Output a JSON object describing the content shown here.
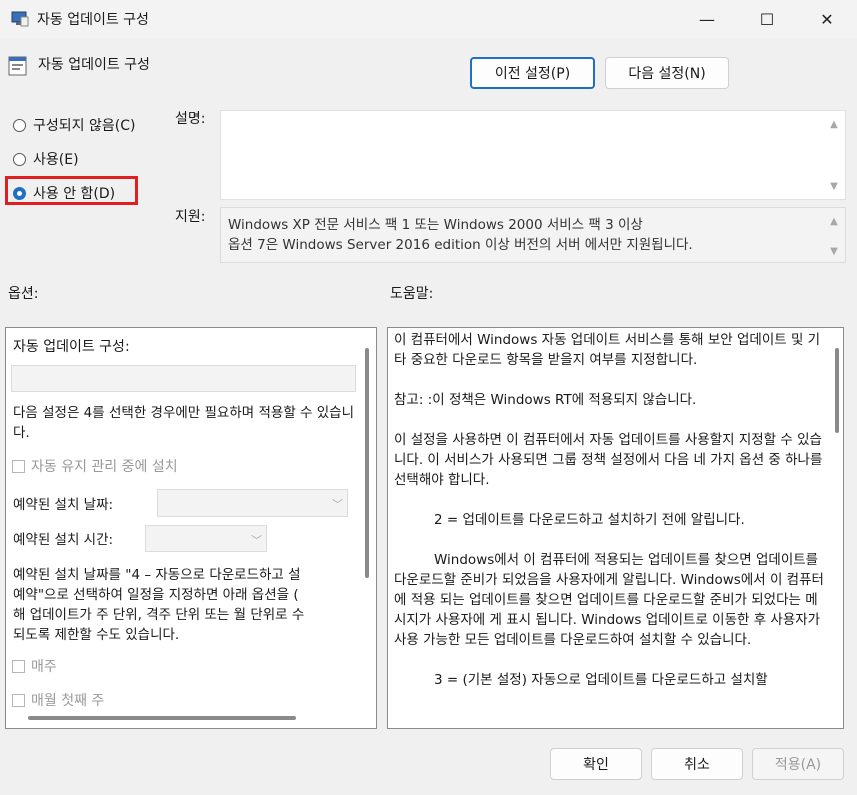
{
  "window": {
    "title": "자동 업데이트 구성",
    "minimize": "—",
    "maximize": "☐",
    "close": "✕"
  },
  "header": {
    "policy_name": "자동 업데이트 구성",
    "prev_button": "이전 설정(P)",
    "next_button": "다음 설정(N)"
  },
  "state": {
    "not_configured": "구성되지 않음(C)",
    "enabled": "사용(E)",
    "disabled": "사용 안 함(D)",
    "selected": "disabled"
  },
  "comment": {
    "label": "설명:",
    "value": ""
  },
  "supported": {
    "label": "지원:",
    "line1": "Windows XP 전문 서비스 팩 1 또는 Windows 2000 서비스 팩 3 이상",
    "line2": "옵션 7은 Windows Server 2016 edition 이상 버전의 서버 에서만 지원됩니다."
  },
  "options": {
    "label": "옵션:",
    "configure_label": "자동 업데이트 구성:",
    "configure_value": "",
    "note1": "다음 설정은 4를 선택한 경우에만 필요하며 적용할 수 있습니다.",
    "maintenance": "자동 유지 관리 중에 설치",
    "install_day_label": "예약된 설치 날짜:",
    "install_time_label": "예약된 설치 시간:",
    "note2_l1": "예약된 설치 날짜를 \"4 – 자동으로 다운로드하고 설",
    "note2_l2": "예약\"으로 선택하여 일정을 지정하면 아래 옵션을 (",
    "note2_l3": "해 업데이트가 주 단위, 격주 단위 또는 월 단위로 수",
    "note2_l4": "되도록 제한할 수도 있습니다.",
    "weekly": "매주",
    "first_week": "매월 첫째 주"
  },
  "help": {
    "label": "도움말:",
    "p1": "이 컴퓨터에서 Windows 자동 업데이트 서비스를 통해 보안 업데이트 및 기타 중요한 다운로드 항목을 받을지 여부를 지정합니다.",
    "p2": "참고: :이 정책은 Windows RT에 적용되지 않습니다.",
    "p3": "이 설정을 사용하면 이 컴퓨터에서 자동 업데이트를 사용할지 지정할 수 있습니다. 이 서비스가 사용되면 그룹 정책 설정에서 다음 네 가지 옵션 중 하나를 선택해야 합니다.",
    "p4": "2 = 업데이트를 다운로드하고 설치하기 전에 알립니다.",
    "p5": "Windows에서 이 컴퓨터에 적용되는 업데이트를 찾으면 업데이트를 다운로드할 준비가 되었음을 사용자에게 알립니다. Windows에서 이 컴퓨터에 적용 되는 업데이트를 찾으면 업데이트를 다운로드할 준비가 되었다는 메시지가 사용자에 게 표시 됩니다. Windows 업데이트로 이동한 후 사용자가 사용 가능한 모든 업데이트를 다운로드하여 설치할 수 있습니다.",
    "p6": "3 = (기본 설정) 자동으로 업데이트를 다운로드하고 설치할"
  },
  "footer": {
    "ok": "확인",
    "cancel": "취소",
    "apply": "적용(A)"
  }
}
